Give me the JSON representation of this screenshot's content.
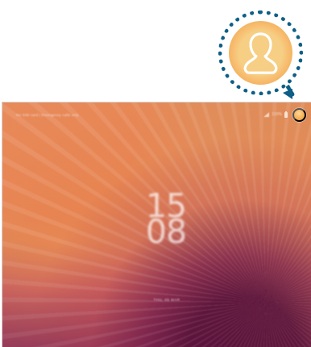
{
  "status_bar": {
    "carrier": "No SIM card | Emergency calls only",
    "battery": "100%"
  },
  "lock_screen": {
    "hour": "15",
    "minute": "08",
    "date": "THU, 05 MAR"
  },
  "icons": {
    "profile_callout": "profile-icon",
    "status_user": "user-icon",
    "signal": "signal-icon",
    "battery": "battery-icon"
  },
  "colors": {
    "callout_border": "#0d5f86",
    "profile_fill": "#f6cf84",
    "profile_accent": "#e59a3c",
    "wallpaper_orange": "#e38c59",
    "wallpaper_magenta": "#59123a"
  }
}
